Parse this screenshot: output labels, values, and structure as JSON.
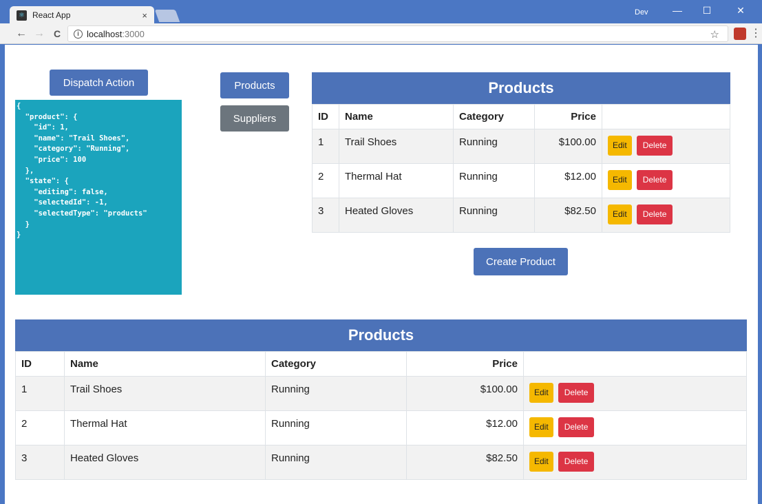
{
  "browser": {
    "tab_title": "React App",
    "tab_close": "×",
    "profile_label": "Dev",
    "url_host": "localhost",
    "url_port": ":3000",
    "window_controls": {
      "minimize": "—",
      "maximize": "☐",
      "close": "✕"
    },
    "nav": {
      "back": "←",
      "forward": "→",
      "reload": "C"
    }
  },
  "page": {
    "dispatch_label": "Dispatch Action",
    "state_json": "{\n  \"product\": {\n    \"id\": 1,\n    \"name\": \"Trail Shoes\",\n    \"category\": \"Running\",\n    \"price\": 100\n  },\n  \"state\": {\n    \"editing\": false,\n    \"selectedId\": -1,\n    \"selectedType\": \"products\"\n  }\n}",
    "selector": {
      "products_label": "Products",
      "suppliers_label": "Suppliers"
    },
    "create_label": "Create Product",
    "table": {
      "title": "Products",
      "columns": {
        "id": "ID",
        "name": "Name",
        "category": "Category",
        "price": "Price"
      },
      "rows": [
        {
          "id": "1",
          "name": "Trail Shoes",
          "category": "Running",
          "price": "$100.00"
        },
        {
          "id": "2",
          "name": "Thermal Hat",
          "category": "Running",
          "price": "$12.00"
        },
        {
          "id": "3",
          "name": "Heated Gloves",
          "category": "Running",
          "price": "$82.50"
        }
      ],
      "edit_label": "Edit",
      "delete_label": "Delete"
    }
  },
  "colors": {
    "primary": "#4c72b8",
    "secondary": "#6c757d",
    "info": "#1ba4bd",
    "warning": "#f5b800",
    "danger": "#dc3545"
  }
}
